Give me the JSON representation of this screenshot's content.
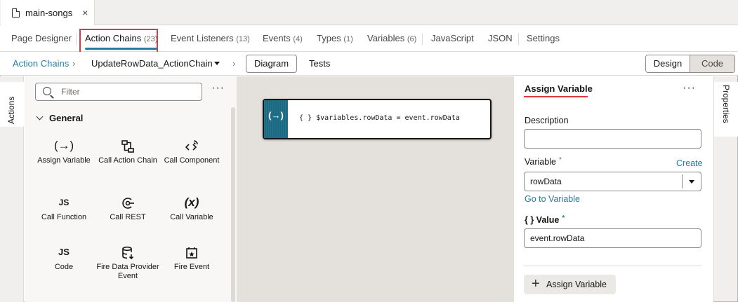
{
  "file_tab": {
    "name": "main-songs",
    "close": "×"
  },
  "tabs": [
    {
      "label": "Page Designer",
      "count": ""
    },
    {
      "label": "Action Chains",
      "count": "(23)"
    },
    {
      "label": "Event Listeners",
      "count": "(13)"
    },
    {
      "label": "Events",
      "count": "(4)"
    },
    {
      "label": "Types",
      "count": "(1)"
    },
    {
      "label": "Variables",
      "count": "(6)"
    },
    {
      "label": "JavaScript",
      "count": ""
    },
    {
      "label": "JSON",
      "count": ""
    },
    {
      "label": "Settings",
      "count": ""
    }
  ],
  "breadcrumb": {
    "root": "Action Chains",
    "separator": "›",
    "current": "UpdateRowData_ActionChain",
    "diagram": "Diagram",
    "tests": "Tests"
  },
  "view_toggle": {
    "design": "Design",
    "code": "Code"
  },
  "left_tab": "Actions",
  "right_tab": "Properties",
  "palette": {
    "filter_placeholder": "Filter",
    "more": "···",
    "section": "General",
    "items": [
      {
        "label": "Assign Variable",
        "icon": "(→)"
      },
      {
        "label": "Call Action Chain",
        "icon": "action-chain-icon"
      },
      {
        "label": "Call Component",
        "icon": "call-component-icon"
      },
      {
        "label": "Call Function",
        "icon": "JS"
      },
      {
        "label": "Call REST",
        "icon": "call-rest-icon"
      },
      {
        "label": "Call Variable",
        "icon": "(x)"
      },
      {
        "label": "Code",
        "icon": "JS"
      },
      {
        "label": "Fire Data Provider Event",
        "icon": "database-icon"
      },
      {
        "label": "Fire Event",
        "icon": "calendar-star-icon"
      }
    ]
  },
  "canvas": {
    "node_icon": "(→)",
    "node_expression": "{ } $variables.rowData = event.rowData"
  },
  "properties": {
    "title": "Assign Variable",
    "more": "···",
    "description_label": "Description",
    "description_value": "",
    "variable_label": "Variable",
    "required_mark": "*",
    "create_link": "Create",
    "variable_value": "rowData",
    "go_to_variable": "Go to Variable",
    "value_label": "{ }  Value",
    "value_value": "event.rowData",
    "add_button": "Assign Variable",
    "add_icon": "+"
  },
  "colors": {
    "accent": "#227e9e",
    "highlight": "#e0383e",
    "node_stripe": "#1b6a83",
    "canvas_bg": "#e4e1dd"
  }
}
